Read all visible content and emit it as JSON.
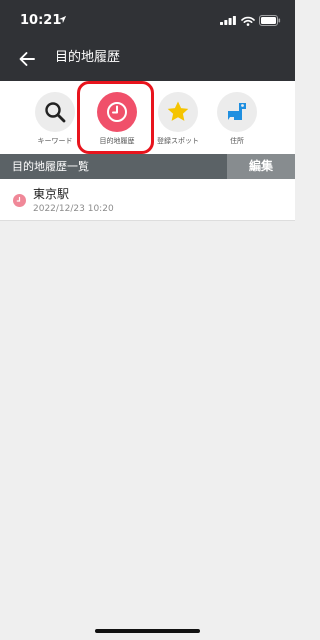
{
  "status_bar": {
    "time": "10:21"
  },
  "header": {
    "title": "目的地履歴"
  },
  "tabs": [
    {
      "label": "キーワード",
      "icon": "search-icon",
      "active": false
    },
    {
      "label": "目的地履歴",
      "icon": "clock-icon",
      "active": true
    },
    {
      "label": "登録スポット",
      "icon": "star-icon",
      "active": false
    },
    {
      "label": "住所",
      "icon": "map-pin-icon",
      "active": false
    }
  ],
  "section": {
    "title": "目的地履歴一覧",
    "edit_label": "編集"
  },
  "history": [
    {
      "name": "東京駅",
      "date": "2022/12/23 10:20"
    }
  ],
  "colors": {
    "active_tab": "#f0506a",
    "highlight": "#e8141d",
    "star": "#f5c400",
    "pin": "#1f8fe0",
    "header_bg": "#303236"
  }
}
